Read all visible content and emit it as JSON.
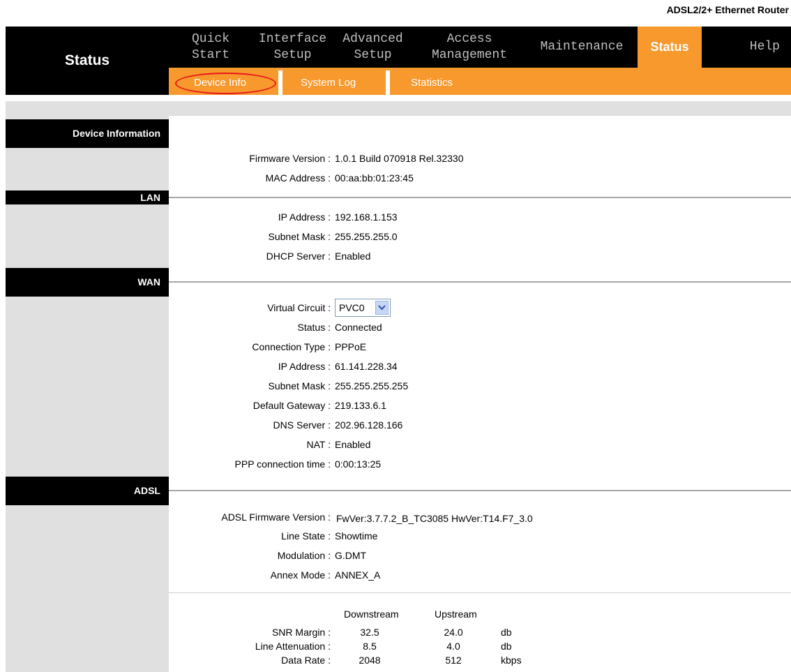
{
  "brand": "ADSL2/2+ Ethernet Router",
  "section_title": "Status",
  "nav": {
    "items": [
      {
        "label": "Quick\nStart"
      },
      {
        "label": "Interface\nSetup"
      },
      {
        "label": "Advanced\nSetup"
      },
      {
        "label": "Access\nManagement"
      },
      {
        "label": "Maintenance"
      },
      {
        "label": "Status"
      },
      {
        "label": "Help"
      }
    ],
    "active": "Status"
  },
  "subnav": {
    "items": [
      "Device Info",
      "System Log",
      "Statistics"
    ],
    "active": "Device Info"
  },
  "sections": {
    "device_information": "Device Information",
    "lan": "LAN",
    "wan": "WAN",
    "adsl": "ADSL"
  },
  "device": {
    "firmware_label": "Firmware Version :",
    "firmware_value": "1.0.1 Build 070918 Rel.32330",
    "mac_label": "MAC Address :",
    "mac_value": "00:aa:bb:01:23:45"
  },
  "lan": {
    "ip_label": "IP Address :",
    "ip_value": "192.168.1.153",
    "mask_label": "Subnet Mask :",
    "mask_value": "255.255.255.0",
    "dhcp_label": "DHCP Server :",
    "dhcp_value": "Enabled"
  },
  "wan": {
    "vc_label": "Virtual Circuit :",
    "vc_value": "PVC0",
    "status_label": "Status :",
    "status_value": "Connected",
    "conn_type_label": "Connection Type :",
    "conn_type_value": "PPPoE",
    "ip_label": "IP Address :",
    "ip_value": "61.141.228.34",
    "mask_label": "Subnet Mask :",
    "mask_value": "255.255.255.255",
    "gateway_label": "Default Gateway :",
    "gateway_value": "219.133.6.1",
    "dns_label": "DNS Server :",
    "dns_value": "202.96.128.166",
    "nat_label": "NAT :",
    "nat_value": "Enabled",
    "ppp_time_label": "PPP connection time :",
    "ppp_time_value": "0:00:13:25"
  },
  "adsl": {
    "fw_label": "ADSL Firmware Version :",
    "fw_value": "FwVer:3.7.7.2_B_TC3085 HwVer:T14.F7_3.0",
    "line_state_label": "Line State :",
    "line_state_value": "Showtime",
    "modulation_label": "Modulation :",
    "modulation_value": "G.DMT",
    "annex_label": "Annex Mode :",
    "annex_value": "ANNEX_A",
    "stats": {
      "headers": [
        "Downstream",
        "Upstream"
      ],
      "rows": [
        {
          "label": "SNR Margin :",
          "down": "32.5",
          "up": "24.0",
          "unit": "db"
        },
        {
          "label": "Line Attenuation :",
          "down": "8.5",
          "up": "4.0",
          "unit": "db"
        },
        {
          "label": "Data Rate :",
          "down": "2048",
          "up": "512",
          "unit": "kbps"
        }
      ]
    }
  },
  "colors": {
    "accent": "#f7992d",
    "header_bg": "#000000",
    "sidebar_bg": "#e0e0e0",
    "highlight_oval": "#e8171d"
  }
}
